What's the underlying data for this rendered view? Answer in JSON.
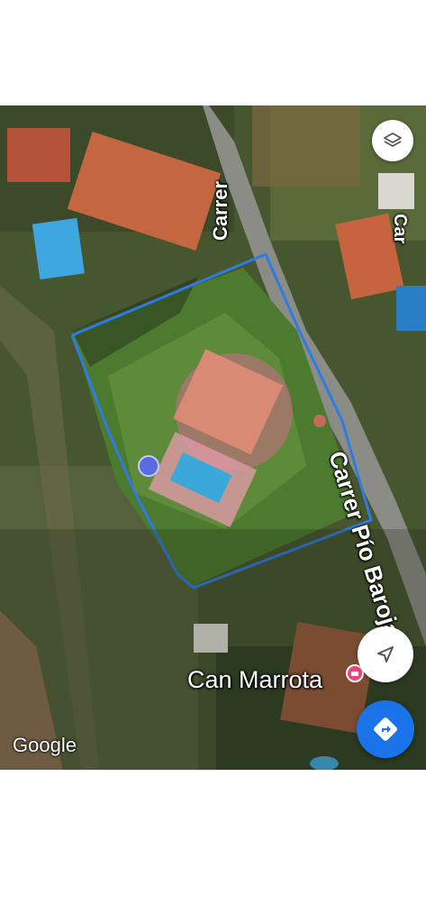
{
  "map": {
    "street_labels": [
      "Carrer",
      "Car",
      "Carrer Pío Baroja"
    ],
    "poi": {
      "name": "Can Marrota",
      "icon": "hotel-bed-icon",
      "marker_color": "#e8457a"
    },
    "attribution": "Google",
    "boundary_color": "#2f7be6"
  },
  "controls": {
    "layers_button": {
      "icon": "layers-icon"
    },
    "locate_button": {
      "icon": "navigation-arrow-icon"
    },
    "directions_button": {
      "icon": "directions-icon",
      "color": "#1a73e8"
    }
  }
}
